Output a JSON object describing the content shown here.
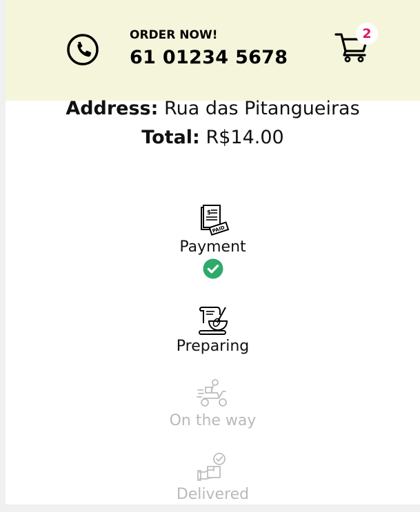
{
  "header": {
    "order_label": "ORDER NOW!",
    "phone_number": "61 01234 5678",
    "cart_count": "2",
    "background_color": "#f5f5dc",
    "badge_color": "#d81b60",
    "icons": [
      "phone-icon",
      "cart-icon"
    ]
  },
  "order": {
    "address_label": "Address:",
    "address_value": "Rua das Pitangueiras",
    "total_label": "Total:",
    "total_value": "R$14.00"
  },
  "steps": [
    {
      "label": "Payment",
      "icon": "paid-receipt-icon",
      "status": "done"
    },
    {
      "label": "Preparing",
      "icon": "cooking-icon",
      "status": "active"
    },
    {
      "label": "On the way",
      "icon": "delivery-scooter-icon",
      "status": "pending"
    },
    {
      "label": "Delivered",
      "icon": "delivered-package-icon",
      "status": "pending"
    }
  ],
  "colors": {
    "check": "#2eaa6a",
    "inactive_text": "#b9b9b9"
  }
}
